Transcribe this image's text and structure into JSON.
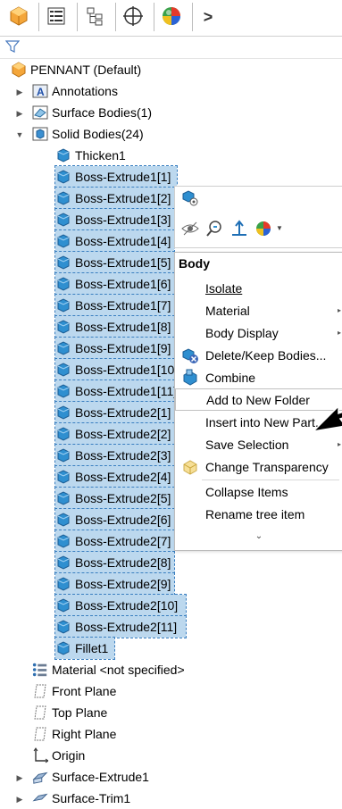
{
  "tabs": [
    {
      "icon": "feature-manager-icon"
    },
    {
      "icon": "property-manager-icon"
    },
    {
      "icon": "configuration-manager-icon"
    },
    {
      "icon": "dimxpert-icon"
    },
    {
      "icon": "display-manager-icon"
    },
    {
      "icon": "chevron-right-icon",
      "label": ">"
    }
  ],
  "filter": {
    "icon": "filter-icon"
  },
  "tree": {
    "root": "PENNANT (Default)",
    "annotations": "Annotations",
    "surface_bodies": "Surface Bodies(1)",
    "solid_bodies": "Solid Bodies(24)",
    "bodies": [
      "Thicken1",
      "Boss-Extrude1[1]",
      "Boss-Extrude1[2]",
      "Boss-Extrude1[3]",
      "Boss-Extrude1[4]",
      "Boss-Extrude1[5]",
      "Boss-Extrude1[6]",
      "Boss-Extrude1[7]",
      "Boss-Extrude1[8]",
      "Boss-Extrude1[9]",
      "Boss-Extrude1[10]",
      "Boss-Extrude1[11]",
      "Boss-Extrude2[1]",
      "Boss-Extrude2[2]",
      "Boss-Extrude2[3]",
      "Boss-Extrude2[4]",
      "Boss-Extrude2[5]",
      "Boss-Extrude2[6]",
      "Boss-Extrude2[7]",
      "Boss-Extrude2[8]",
      "Boss-Extrude2[9]",
      "Boss-Extrude2[10]",
      "Boss-Extrude2[11]",
      "Fillet1"
    ],
    "material": "Material <not specified>",
    "front_plane": "Front Plane",
    "top_plane": "Top Plane",
    "right_plane": "Right Plane",
    "origin": "Origin",
    "surface_extrude": "Surface-Extrude1",
    "surface_trim": "Surface-Trim1"
  },
  "context_menu": {
    "header": "Body",
    "items": [
      {
        "label": "Isolate",
        "accel": "I",
        "submenu": false
      },
      {
        "label": "Material",
        "submenu": true
      },
      {
        "label": "Body Display",
        "submenu": true
      },
      {
        "label": "Delete/Keep Bodies...",
        "accel": "D",
        "submenu": false
      },
      {
        "label": "Combine",
        "accel": "C",
        "submenu": false
      },
      {
        "label": "Add to New Folder",
        "accel": "t",
        "submenu": false
      },
      {
        "label": "Insert into New Part...",
        "accel": "I",
        "submenu": false
      },
      {
        "label": "Save Selection",
        "submenu": true
      },
      {
        "label": "Change Transparency",
        "accel": "g",
        "submenu": false
      },
      {
        "label": "Collapse Items",
        "accel": "o",
        "submenu": false
      },
      {
        "label": "Rename tree item",
        "accel": "R",
        "submenu": false
      }
    ],
    "more": "⌄"
  },
  "colors": {
    "selection_bg": "#bcd8ee",
    "selection_border": "#3a7fc0",
    "body_icon": "#2f8fd0"
  }
}
